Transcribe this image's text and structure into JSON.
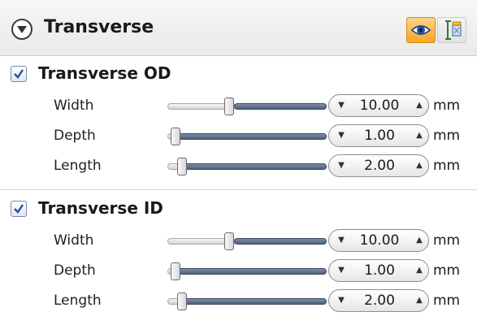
{
  "panel": {
    "title": "Transverse",
    "collapse_icon": "chevron-down-circle-icon",
    "toolbar": [
      {
        "name": "eye-icon",
        "active": true,
        "color": "#f5a623"
      },
      {
        "name": "measure-icon",
        "active": false
      }
    ]
  },
  "sections": [
    {
      "title": "Transverse OD",
      "checked": true,
      "rows": [
        {
          "label": "Width",
          "value": "10.00",
          "unit": "mm",
          "slider_fraction": 0.4
        },
        {
          "label": "Depth",
          "value": "1.00",
          "unit": "mm",
          "slider_fraction": 0.04
        },
        {
          "label": "Length",
          "value": "2.00",
          "unit": "mm",
          "slider_fraction": 0.08
        }
      ]
    },
    {
      "title": "Transverse ID",
      "checked": true,
      "rows": [
        {
          "label": "Width",
          "value": "10.00",
          "unit": "mm",
          "slider_fraction": 0.4
        },
        {
          "label": "Depth",
          "value": "1.00",
          "unit": "mm",
          "slider_fraction": 0.04
        },
        {
          "label": "Length",
          "value": "2.00",
          "unit": "mm",
          "slider_fraction": 0.08
        }
      ]
    }
  ],
  "spinner": {
    "down_icon": "triangle-down-icon",
    "up_icon": "triangle-up-icon"
  }
}
